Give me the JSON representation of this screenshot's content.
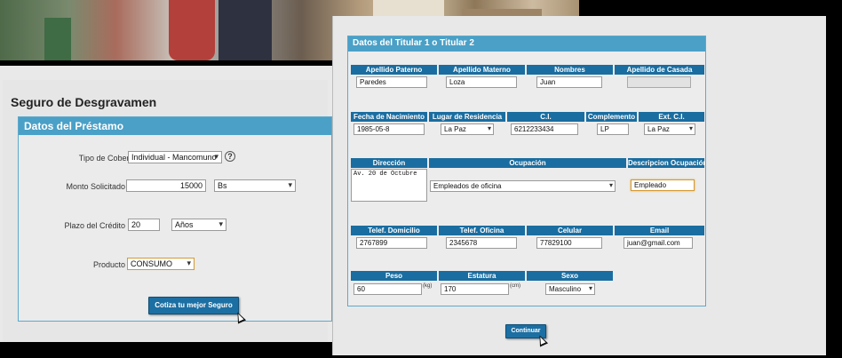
{
  "left": {
    "title": "Seguro de Desgravamen",
    "box_title": "Datos del Préstamo",
    "cobertura": {
      "label": "Tipo de Cobertura",
      "value": "Individual - Mancomuno",
      "help": "?"
    },
    "monto": {
      "label": "Monto Solicitado",
      "value": "15000",
      "currency": "Bs"
    },
    "plazo": {
      "label": "Plazo del Crédito",
      "value": "20",
      "unit": "Años"
    },
    "producto": {
      "label": "Producto",
      "value": "CONSUMO"
    },
    "button": "Cotiza tu mejor Seguro"
  },
  "right": {
    "box_title": "Datos del Titular 1 o Titular 2",
    "row1": {
      "headers": [
        "Apellido Paterno",
        "Apellido Materno",
        "Nombres",
        "Apellido de Casada"
      ],
      "values": [
        "Paredes",
        "Loza",
        "Juan",
        ""
      ]
    },
    "row2": {
      "headers": [
        "Fecha de Nacimiento",
        "Lugar de Residencia",
        "C.I.",
        "Complemento",
        "Ext. C.I."
      ],
      "fecha": "1985-05-8",
      "lugar": "La Paz",
      "ci": "6212233434",
      "complemento": "LP",
      "ext": "La Paz"
    },
    "row3": {
      "headers": [
        "Dirección",
        "Ocupación",
        "Descripcion Ocupación"
      ],
      "direccion": "Av. 20 de Octubre",
      "ocupacion": "Empleados de oficina",
      "descripcion": "Empleado"
    },
    "row4": {
      "headers": [
        "Telef. Domicilio",
        "Telef. Oficina",
        "Celular",
        "Email"
      ],
      "values": [
        "2767899",
        "2345678",
        "77829100",
        "juan@gmail.com"
      ]
    },
    "row5": {
      "headers": [
        "Peso",
        "Estatura",
        "Sexo"
      ],
      "peso": "60",
      "peso_unit": "(kg)",
      "estatura": "170",
      "estatura_unit": "(cm)",
      "sexo": "Masculino"
    },
    "button": "Continuar"
  }
}
